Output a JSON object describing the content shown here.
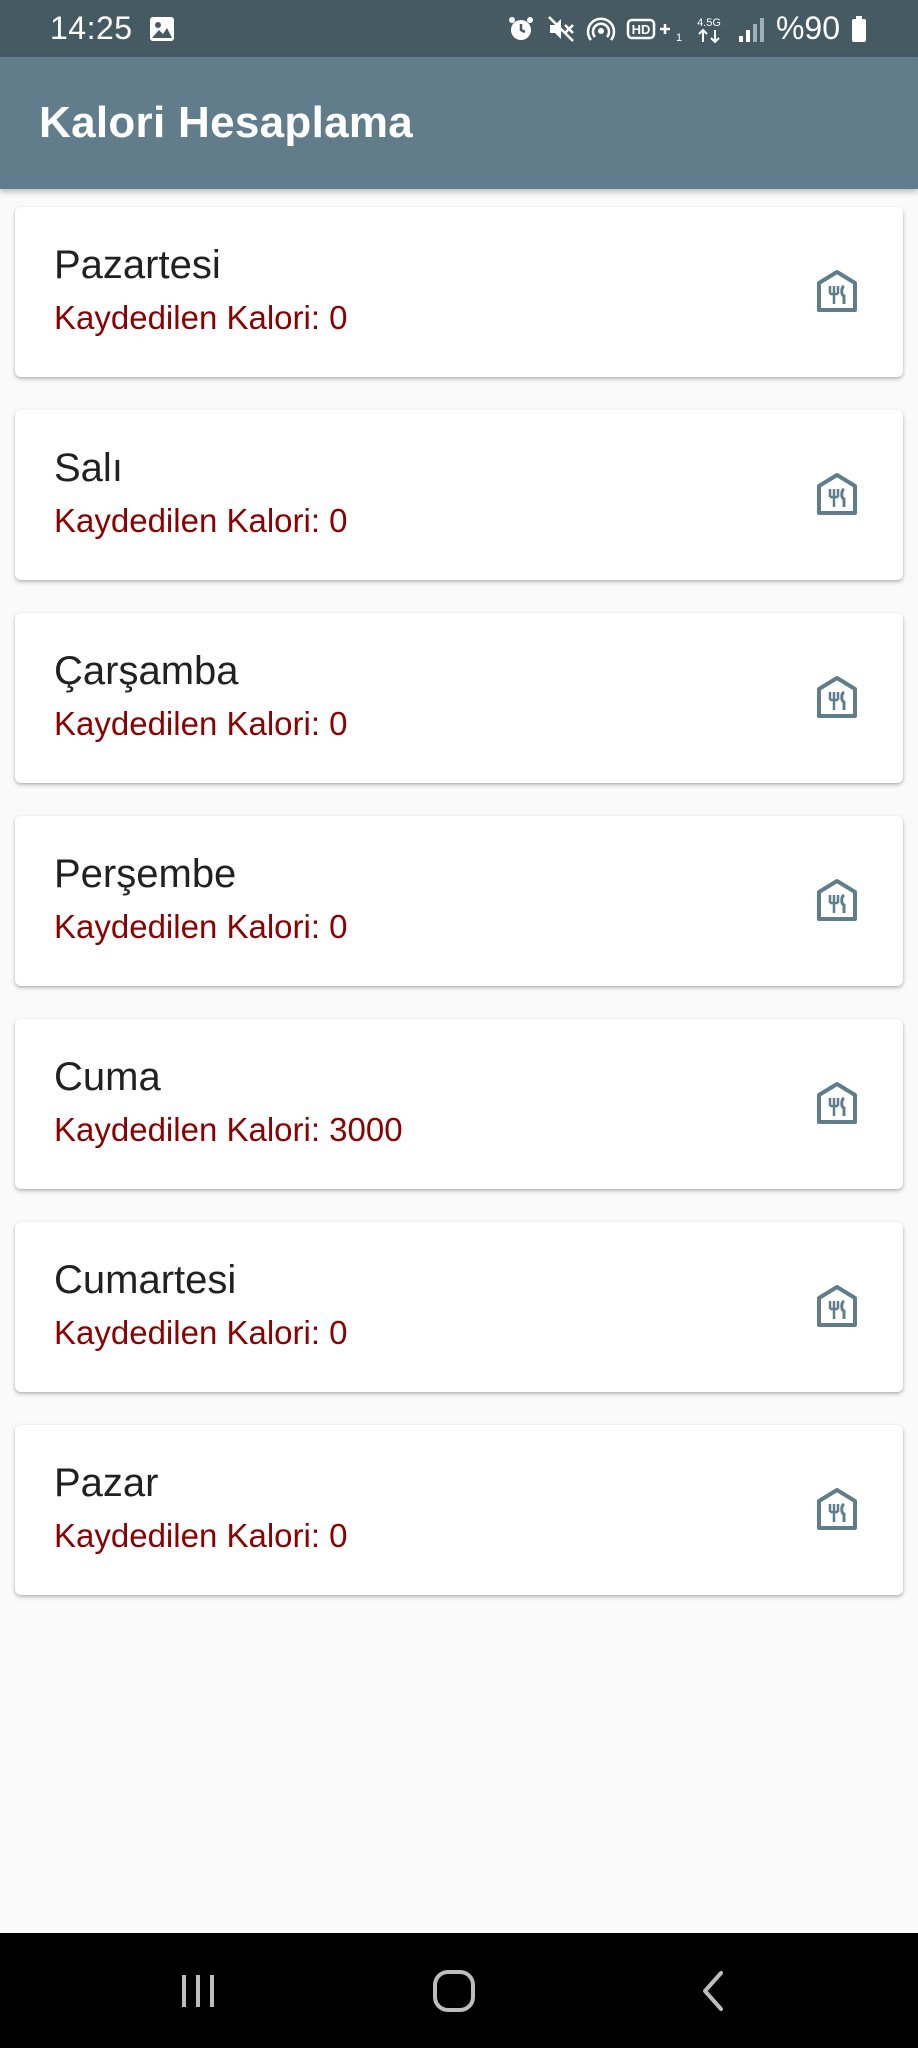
{
  "status_bar": {
    "time": "14:25",
    "battery": "%90",
    "icons": [
      "gallery-icon",
      "alarm-icon",
      "mute-icon",
      "hotspot-icon",
      "hd-volte-icon",
      "network-4-5g-icon",
      "signal-icon",
      "battery-icon"
    ]
  },
  "app_bar": {
    "title": "Kalori Hesaplama"
  },
  "days": [
    {
      "name": "Pazartesi",
      "calorie_text": "Kaydedilen Kalori: 0"
    },
    {
      "name": "Salı",
      "calorie_text": "Kaydedilen Kalori: 0"
    },
    {
      "name": "Çarşamba",
      "calorie_text": "Kaydedilen Kalori: 0"
    },
    {
      "name": "Perşembe",
      "calorie_text": "Kaydedilen Kalori: 0"
    },
    {
      "name": "Cuma",
      "calorie_text": "Kaydedilen Kalori: 3000"
    },
    {
      "name": "Cumartesi",
      "calorie_text": "Kaydedilen Kalori: 0"
    },
    {
      "name": "Pazar",
      "calorie_text": "Kaydedilen Kalori: 0"
    }
  ],
  "colors": {
    "status_bar": "#465a64",
    "app_bar": "#617d8b",
    "calorie_text": "#8b0000",
    "icon": "#607d8b"
  },
  "navigation": [
    "recent-apps-icon",
    "home-icon",
    "back-icon"
  ]
}
